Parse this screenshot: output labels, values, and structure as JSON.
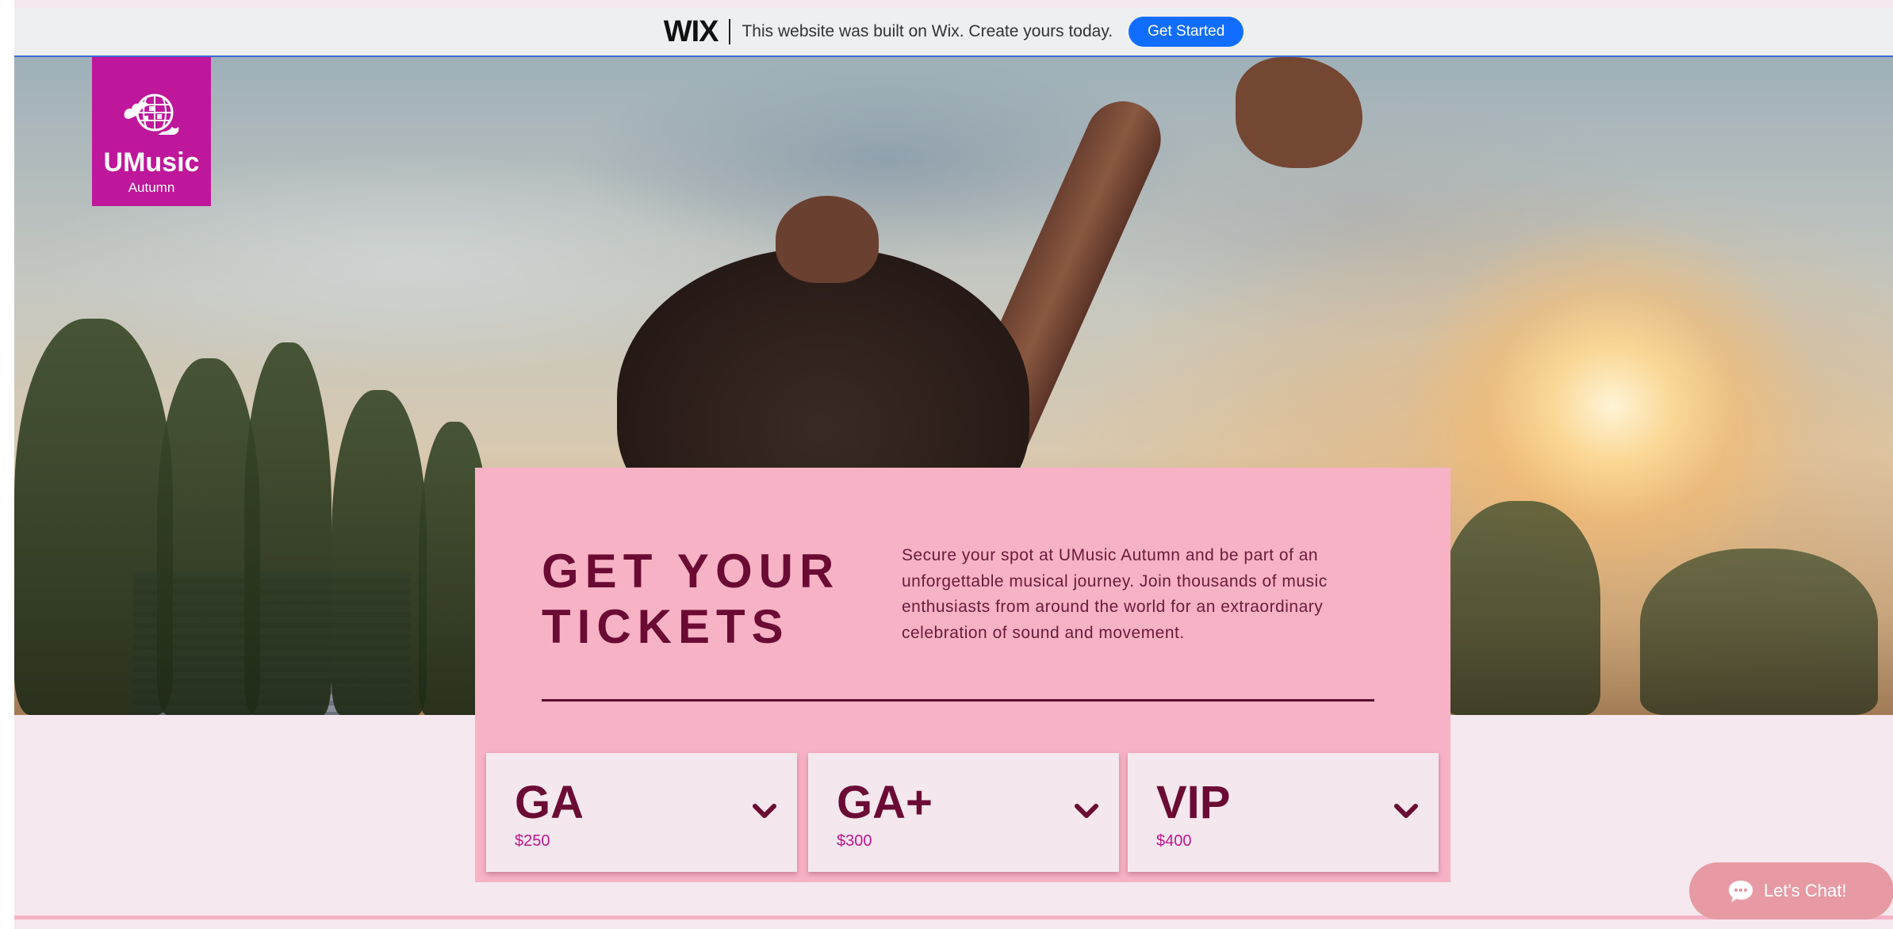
{
  "wix_banner": {
    "logo_text": "WIX",
    "message": "This website was built on Wix. Create yours today.",
    "cta_label": "Get Started"
  },
  "logo": {
    "name": "UMusic",
    "subtitle": "Autumn",
    "background_color": "#bf179b"
  },
  "tickets": {
    "title_line1": "GET YOUR",
    "title_line2": "TICKETS",
    "description": "Secure your spot at UMusic Autumn and be part of an unforgettable musical journey. Join thousands of music enthusiasts from around the world for an extraordinary celebration of sound and movement.",
    "card_color": "#f7b2c5",
    "tiers": [
      {
        "name": "GA",
        "price": "$250",
        "icon": "chevron-down-icon"
      },
      {
        "name": "GA+",
        "price": "$300",
        "icon": "chevron-down-icon"
      },
      {
        "name": "VIP",
        "price": "$400",
        "icon": "chevron-down-icon"
      }
    ]
  },
  "chat": {
    "label": "Let's Chat!",
    "icon": "chat-bubble-icon",
    "color": "#e89aa4"
  },
  "colors": {
    "accent_text": "#6b0b34",
    "price_text": "#c0178e",
    "wix_button": "#116dff"
  }
}
